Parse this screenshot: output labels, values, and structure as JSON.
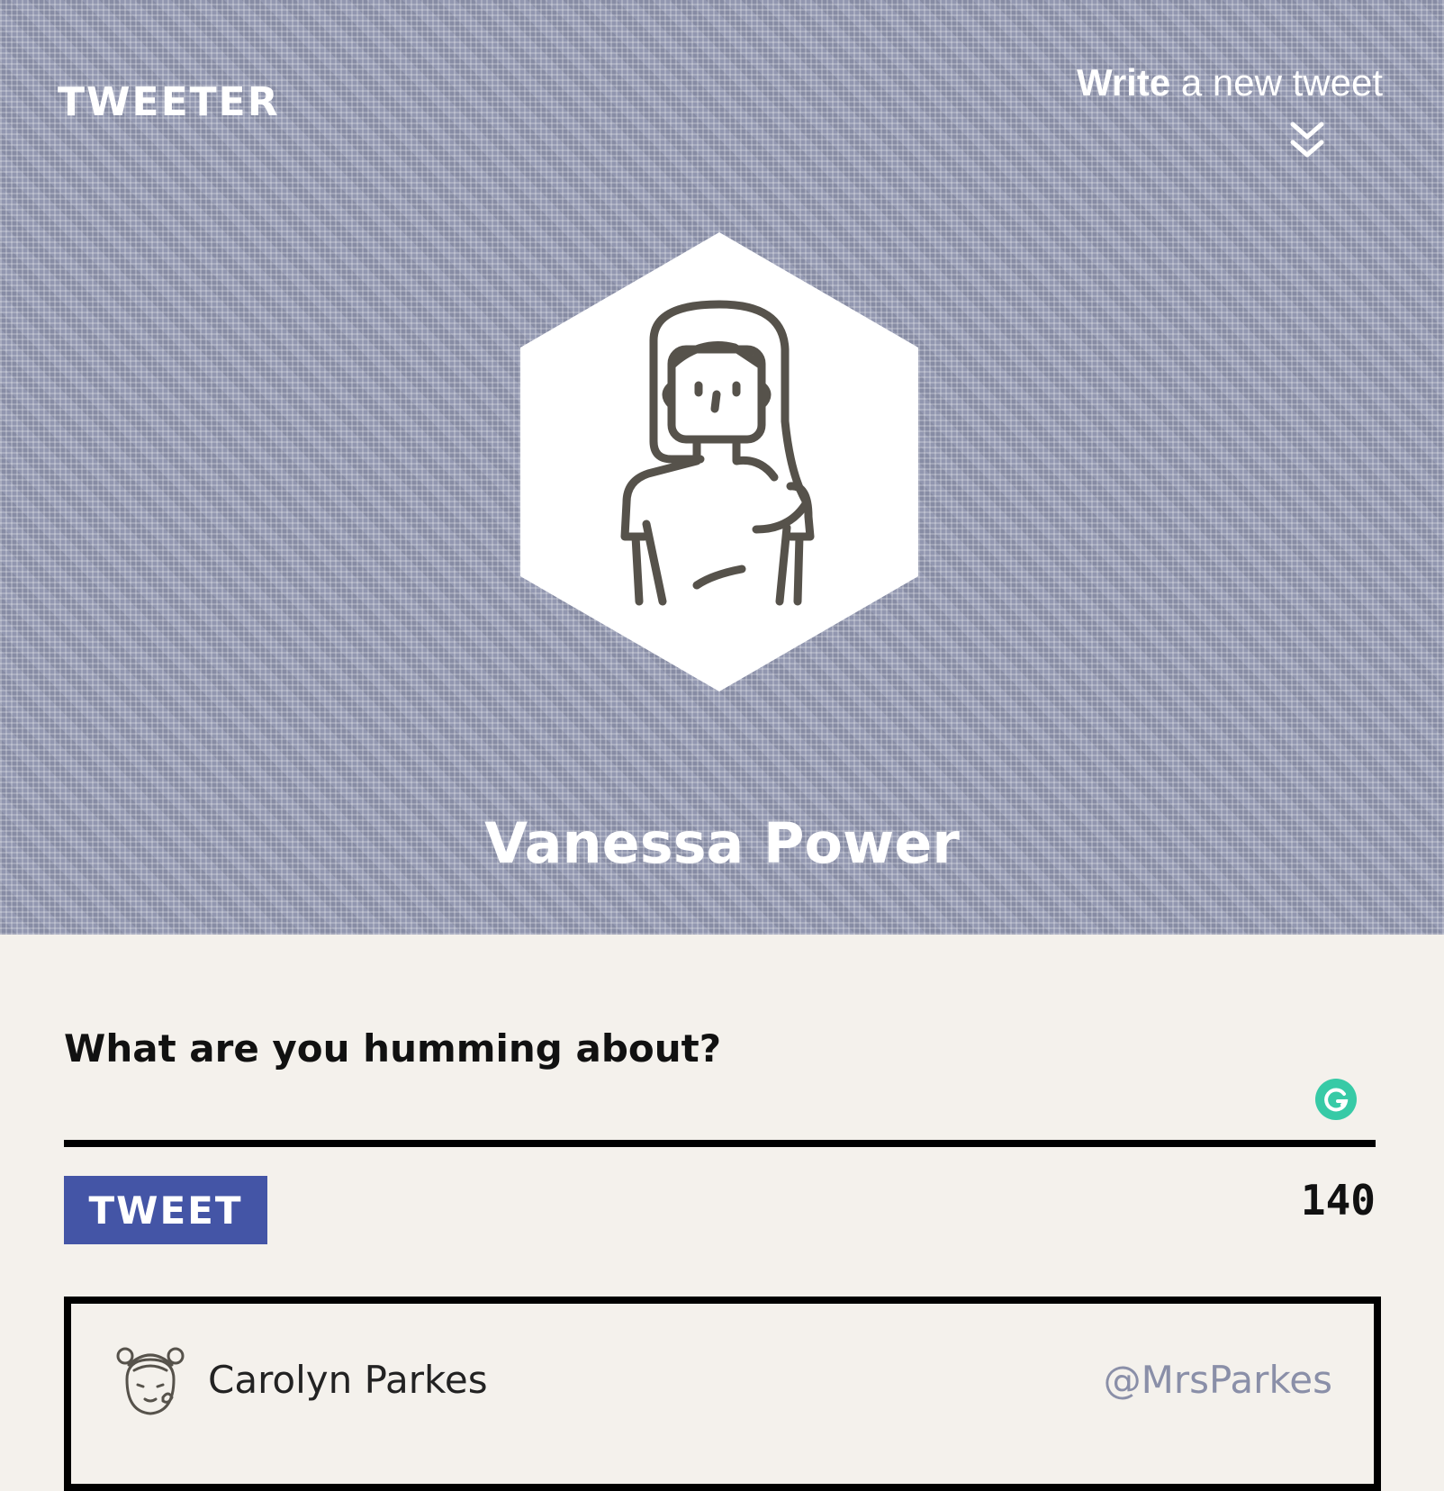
{
  "header": {
    "logo": "TWEETER",
    "write_strong": "Write",
    "write_light": " a new tweet",
    "chevron_icon": "double-chevron-down-icon",
    "avatar_icon": "woman-avatar-icon",
    "user_name": "Vanessa Power"
  },
  "compose": {
    "label": "What are you humming about?",
    "input_value": "",
    "grammarly_icon": "grammarly-icon",
    "tweet_button": "TWEET",
    "char_count": "140"
  },
  "tweets": [
    {
      "name": "Carolyn Parkes",
      "handle": "@MrsParkes",
      "avatar_icon": "woman-avatar-icon"
    }
  ],
  "colors": {
    "header_bg": "#8e93ad",
    "page_bg": "#f4f1ec",
    "button_bg": "#4455a6",
    "handle": "#8a8fa8",
    "grammarly": "#15c39a"
  }
}
